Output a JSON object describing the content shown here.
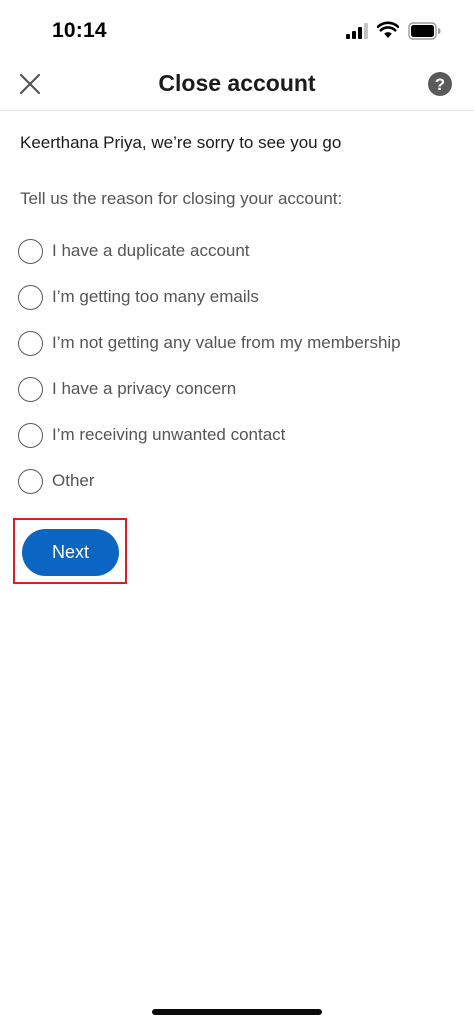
{
  "status_bar": {
    "time": "10:14",
    "icons": [
      "signal-icon",
      "wifi-icon",
      "battery-icon"
    ]
  },
  "header": {
    "title": "Close account",
    "left_icon": "close-icon",
    "right_icon": "help-icon"
  },
  "content": {
    "farewell": "Keerthana Priya, we’re sorry to see you go",
    "prompt": "Tell us the reason for closing your account:",
    "options": [
      {
        "label": "I have a duplicate account",
        "selected": false
      },
      {
        "label": "I’m getting too many emails",
        "selected": false
      },
      {
        "label": "I’m not getting any value from my membership",
        "selected": false
      },
      {
        "label": "I have a privacy concern",
        "selected": false
      },
      {
        "label": "I’m receiving unwanted contact",
        "selected": false
      },
      {
        "label": "Other",
        "selected": false
      }
    ]
  },
  "actions": {
    "next_label": "Next"
  },
  "colors": {
    "accent": "#0a66c2",
    "highlight": "#d3202a",
    "text_primary": "#1b1b1b",
    "text_secondary": "#555555"
  }
}
